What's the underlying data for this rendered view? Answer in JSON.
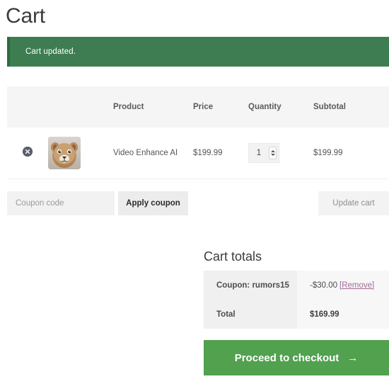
{
  "page": {
    "title": "Cart"
  },
  "notice": {
    "message": "Cart updated.",
    "background_color": "#3d7d51",
    "accent_color": "#2f6b42"
  },
  "cart_table": {
    "headers": {
      "remove": "",
      "thumbnail": "",
      "product": "Product",
      "price": "Price",
      "quantity": "Quantity",
      "subtotal": "Subtotal"
    },
    "rows": [
      {
        "remove_icon": "remove-circle-icon",
        "thumbnail_alt": "lion-cub-product-image",
        "product": "Video Enhance AI",
        "price": "$199.99",
        "quantity": "1",
        "subtotal": "$199.99"
      }
    ]
  },
  "actions": {
    "coupon_placeholder": "Coupon code",
    "coupon_value": "",
    "apply_coupon_label": "Apply coupon",
    "update_cart_label": "Update cart"
  },
  "cart_totals": {
    "heading": "Cart totals",
    "rows": [
      {
        "label": "Coupon: rumors15",
        "value": "-$30.00",
        "link": "[Remove]",
        "link_color": "#a06b96"
      },
      {
        "label": "Total",
        "value": "$169.99"
      }
    ]
  },
  "checkout": {
    "label": "Proceed to checkout",
    "arrow": "→",
    "background_color": "#51a14f"
  }
}
